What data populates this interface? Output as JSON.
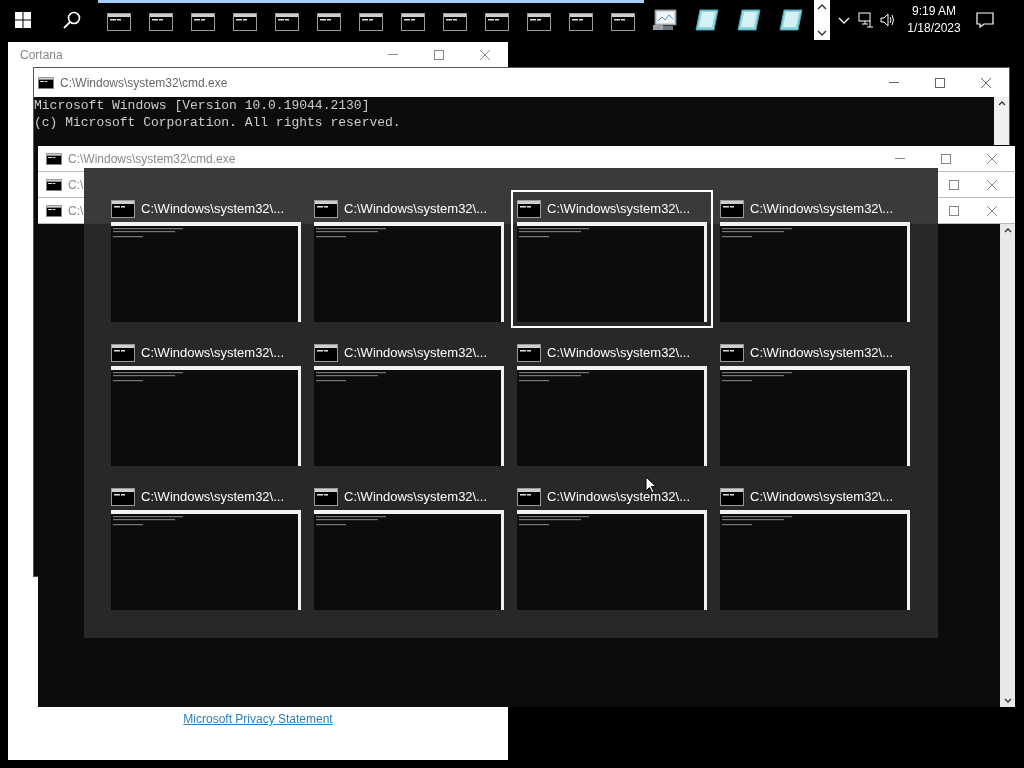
{
  "taskbar": {
    "apps": [
      {
        "kind": "console"
      },
      {
        "kind": "console"
      },
      {
        "kind": "console"
      },
      {
        "kind": "console"
      },
      {
        "kind": "console"
      },
      {
        "kind": "console"
      },
      {
        "kind": "console"
      },
      {
        "kind": "console"
      },
      {
        "kind": "console"
      },
      {
        "kind": "console"
      },
      {
        "kind": "console"
      },
      {
        "kind": "console"
      },
      {
        "kind": "console"
      },
      {
        "kind": "monitor"
      },
      {
        "kind": "tablet"
      },
      {
        "kind": "tablet"
      },
      {
        "kind": "tablet"
      }
    ],
    "clock": {
      "time": "9:19 AM",
      "date": "1/18/2023"
    }
  },
  "cortana": {
    "title": "Cortana",
    "link": "Microsoft Privacy Statement"
  },
  "console_window": {
    "title": "C:\\Windows\\system32\\cmd.exe",
    "lines": [
      "Microsoft Windows [Version 10.0.19044.2130]",
      "(c) Microsoft Corporation. All rights reserved."
    ]
  },
  "stacked_windows": [
    {
      "title": "C:\\Windows\\system32\\cmd.exe"
    },
    {
      "title": "C:\\"
    },
    {
      "title": "C:\\"
    }
  ],
  "switcher": {
    "items": [
      {
        "title": "C:\\Windows\\system32\\...",
        "selected": false
      },
      {
        "title": "C:\\Windows\\system32\\...",
        "selected": false
      },
      {
        "title": "C:\\Windows\\system32\\...",
        "selected": true
      },
      {
        "title": "C:\\Windows\\system32\\...",
        "selected": false
      },
      {
        "title": "C:\\Windows\\system32\\...",
        "selected": false
      },
      {
        "title": "C:\\Windows\\system32\\...",
        "selected": false
      },
      {
        "title": "C:\\Windows\\system32\\...",
        "selected": false
      },
      {
        "title": "C:\\Windows\\system32\\...",
        "selected": false
      },
      {
        "title": "C:\\Windows\\system32\\...",
        "selected": false
      },
      {
        "title": "C:\\Windows\\system32\\...",
        "selected": false
      },
      {
        "title": "C:\\Windows\\system32\\...",
        "selected": false
      },
      {
        "title": "C:\\Windows\\system32\\...",
        "selected": false
      }
    ]
  }
}
